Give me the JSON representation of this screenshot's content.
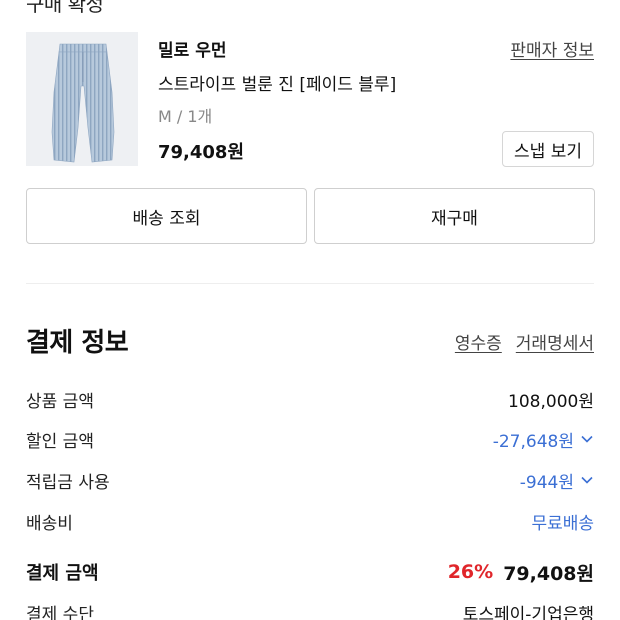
{
  "header": {
    "status": "구매 확정"
  },
  "product": {
    "image_alt": "striped balloon jeans",
    "brand": "밀로 우먼",
    "seller_info_label": "판매자 정보",
    "name": "스트라이프 벌룬 진 [페이드 블루]",
    "option": "M / 1개",
    "price": "79,408원",
    "snap_label": "스냅 보기"
  },
  "actions": {
    "track_delivery": "배송 조회",
    "reorder": "재구매"
  },
  "payment": {
    "title": "결제 정보",
    "receipt_label": "영수증",
    "statement_label": "거래명세서",
    "rows": {
      "product_amount": {
        "label": "상품 금액",
        "value": "108,000원"
      },
      "discount_amount": {
        "label": "할인 금액",
        "value": "-27,648원"
      },
      "points_used": {
        "label": "적립금 사용",
        "value": "-944원"
      },
      "shipping_fee": {
        "label": "배송비",
        "value": "무료배송"
      },
      "total": {
        "label": "결제 금액",
        "rate": "26%",
        "value": "79,408원"
      },
      "method": {
        "label": "결제 수단",
        "value": "토스페이-기업은행"
      }
    }
  },
  "colors": {
    "accent_blue": "#3b6fd4",
    "discount_red": "#e0262b",
    "jeans_blue": "#a9bfd6"
  }
}
